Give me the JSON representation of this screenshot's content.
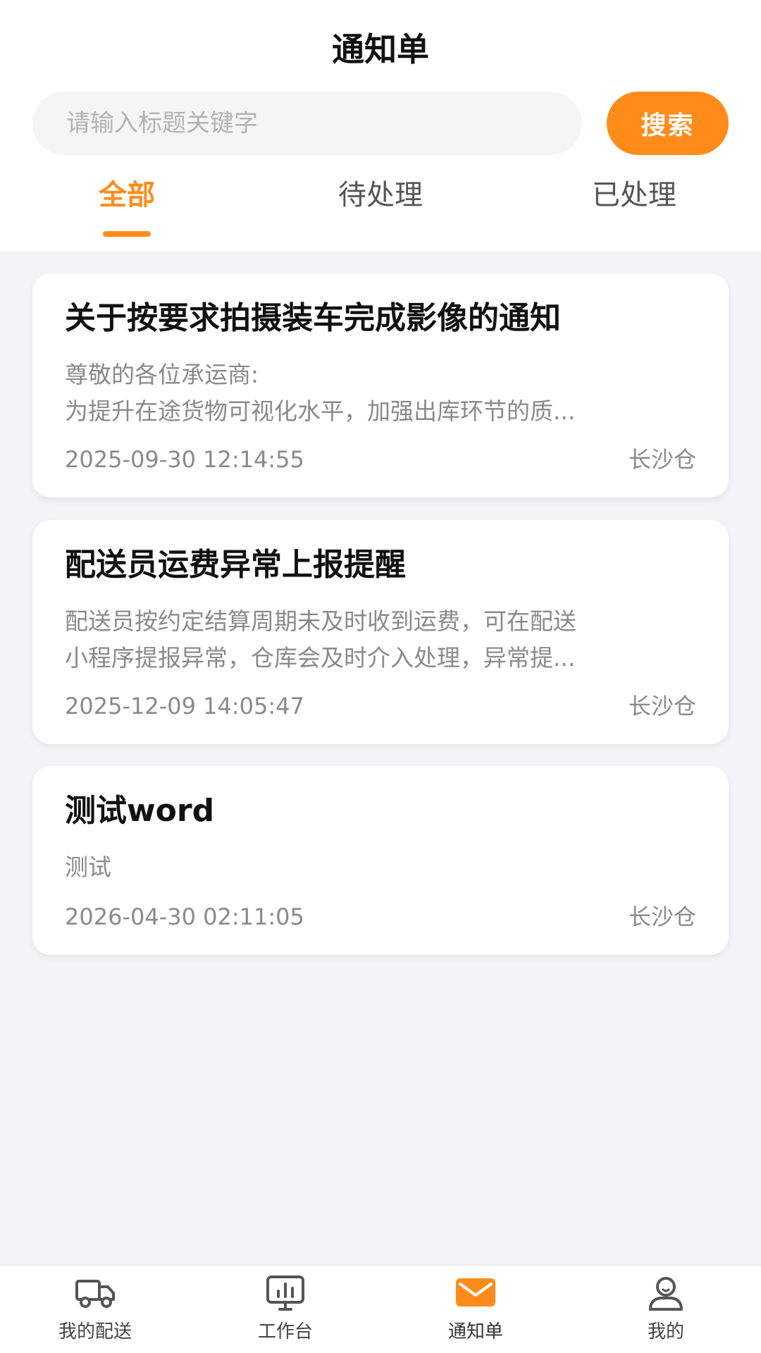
{
  "header": {
    "title": "通知单"
  },
  "search": {
    "placeholder": "请输入标题关键字",
    "value": "",
    "button_label": "搜索"
  },
  "tabs": [
    {
      "label": "全部",
      "active": true
    },
    {
      "label": "待处理",
      "active": false
    },
    {
      "label": "已处理",
      "active": false
    }
  ],
  "notices": [
    {
      "title": "关于按要求拍摄装车完成影像的通知",
      "body_lines": [
        "尊敬的各位承运商:",
        "为提升在途货物可视化水平，加强出库环节的质..."
      ],
      "time": "2025-09-30 12:14:55",
      "location": "长沙仓"
    },
    {
      "title": "配送员运费异常上报提醒",
      "body_lines": [
        "配送员按约定结算周期未及时收到运费，可在配送",
        "小程序提报异常，仓库会及时介入处理，异常提..."
      ],
      "time": "2025-12-09 14:05:47",
      "location": "长沙仓"
    },
    {
      "title": "测试word",
      "body_lines": [
        "测试"
      ],
      "time": "2026-04-30 02:11:05",
      "location": "长沙仓"
    }
  ],
  "bottom_nav": [
    {
      "label": "我的配送",
      "icon": "truck-icon",
      "active": false
    },
    {
      "label": "工作台",
      "icon": "monitor-chart-icon",
      "active": false
    },
    {
      "label": "通知单",
      "icon": "mail-icon",
      "active": true
    },
    {
      "label": "我的",
      "icon": "user-icon",
      "active": false
    }
  ],
  "colors": {
    "accent": "#ff8c1a",
    "background": "#f3f3f8",
    "card": "#ffffff",
    "muted_text": "#8a8a8a",
    "icon_gray": "#555555"
  }
}
